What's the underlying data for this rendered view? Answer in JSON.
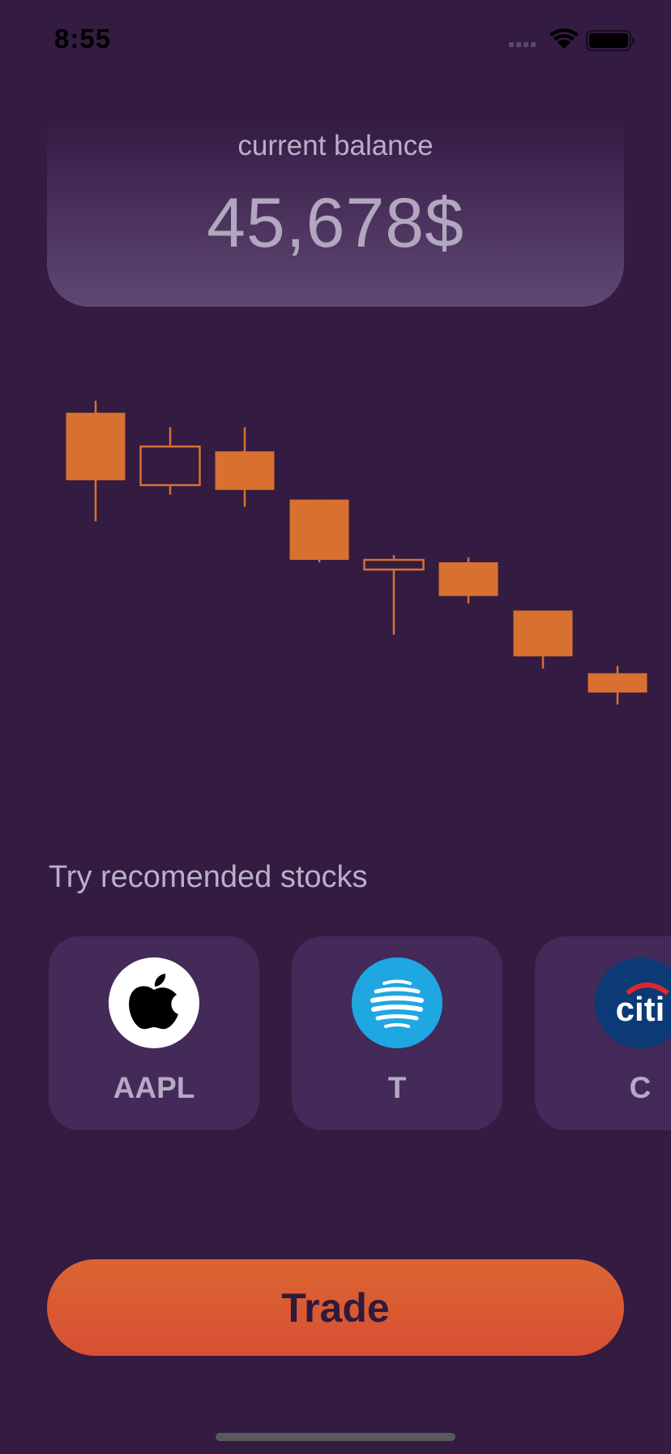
{
  "status_bar": {
    "time": "8:55",
    "icons": [
      "signal-icon",
      "wifi-icon",
      "battery-icon"
    ]
  },
  "balance": {
    "label": "current balance",
    "value": "45,678$"
  },
  "chart_data": {
    "type": "candlestick",
    "style": {
      "color": "#d8702f"
    },
    "candles": [
      {
        "open": 95,
        "close": 67,
        "high": 100,
        "low": 50,
        "filled": true
      },
      {
        "open": 65,
        "close": 81,
        "high": 89,
        "low": 61,
        "filled": false
      },
      {
        "open": 79,
        "close": 63,
        "high": 89,
        "low": 56,
        "filled": true
      },
      {
        "open": 59,
        "close": 34,
        "high": 59,
        "low": 33,
        "filled": true
      },
      {
        "open": 30,
        "close": 34,
        "high": 36,
        "low": 3,
        "filled": false
      },
      {
        "open": 33,
        "close": 19,
        "high": 35,
        "low": 16,
        "filled": true
      },
      {
        "open": 13,
        "close": -6,
        "high": 13,
        "low": -11,
        "filled": true
      },
      {
        "open": -13,
        "close": -21,
        "high": -10,
        "low": -26,
        "filled": true
      }
    ],
    "ylim": [
      -40,
      106
    ]
  },
  "recommended": {
    "title": "Try recomended stocks",
    "stocks": [
      {
        "ticker": "AAPL",
        "logo": "apple-logo-icon",
        "logo_bg": "#ffffff"
      },
      {
        "ticker": "T",
        "logo": "att-globe-logo-icon",
        "logo_bg": "#1ea7e0"
      },
      {
        "ticker": "C",
        "logo": "citi-logo-icon",
        "logo_bg": "#0b3a77",
        "logo_text": "citi"
      }
    ]
  },
  "trade_button": {
    "label": "Trade"
  },
  "colors": {
    "background": "#331b41",
    "card": "#432a58",
    "accent": "#d8702f",
    "text_muted": "#b9b0c7"
  }
}
